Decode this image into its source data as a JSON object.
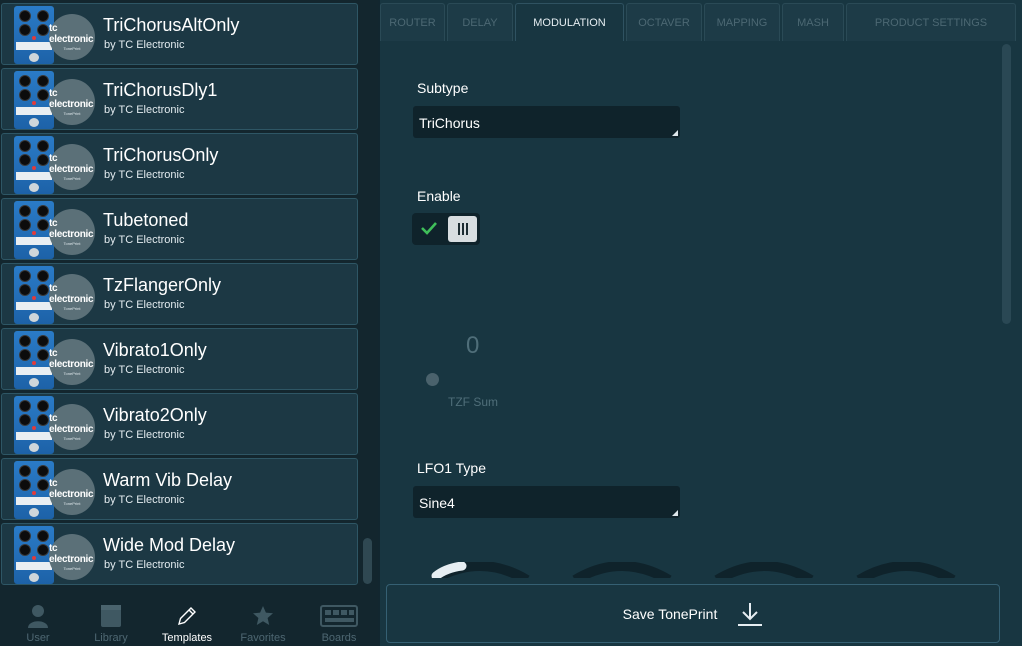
{
  "templates": [
    {
      "title": "TriChorusAltOnly",
      "author": "by TC Electronic"
    },
    {
      "title": "TriChorusDly1",
      "author": "by TC Electronic"
    },
    {
      "title": "TriChorusOnly",
      "author": "by TC Electronic"
    },
    {
      "title": "Tubetoned",
      "author": "by TC Electronic"
    },
    {
      "title": "TzFlangerOnly",
      "author": "by TC Electronic"
    },
    {
      "title": "Vibrato1Only",
      "author": "by TC Electronic"
    },
    {
      "title": "Vibrato2Only",
      "author": "by TC Electronic"
    },
    {
      "title": "Warm Vib Delay",
      "author": "by TC Electronic"
    },
    {
      "title": "Wide Mod Delay",
      "author": "by TC Electronic"
    }
  ],
  "brand": {
    "logo_text": "tc electronic",
    "logo_sub": "TonePrint"
  },
  "bottom_nav": [
    {
      "label": "User",
      "icon": "user-icon",
      "active": false
    },
    {
      "label": "Library",
      "icon": "library-icon",
      "active": false
    },
    {
      "label": "Templates",
      "icon": "pencil-icon",
      "active": true
    },
    {
      "label": "Favorites",
      "icon": "star-icon",
      "active": false
    },
    {
      "label": "Boards",
      "icon": "pedalboard-icon",
      "active": false
    }
  ],
  "tabs": [
    {
      "label": "ROUTER",
      "active": false
    },
    {
      "label": "DELAY",
      "active": false
    },
    {
      "label": "MODULATION",
      "active": true
    },
    {
      "label": "OCTAVER",
      "active": false
    },
    {
      "label": "MAPPING",
      "active": false
    },
    {
      "label": "MASH",
      "active": false
    },
    {
      "label": "PRODUCT SETTINGS",
      "active": false
    }
  ],
  "modulation": {
    "subtype_label": "Subtype",
    "subtype_value": "TriChorus",
    "enable_label": "Enable",
    "enable_on": true,
    "tzf_sum_value": "0",
    "tzf_sum_label": "TZF Sum",
    "lfo1_type_label": "LFO1 Type",
    "lfo1_type_value": "Sine4"
  },
  "save_button": {
    "label": "Save TonePrint",
    "icon": "download-icon"
  },
  "colors": {
    "accent": "#2e5665",
    "enable_check": "#3fbf5a",
    "pedal_blue": "#2a7bc7"
  }
}
